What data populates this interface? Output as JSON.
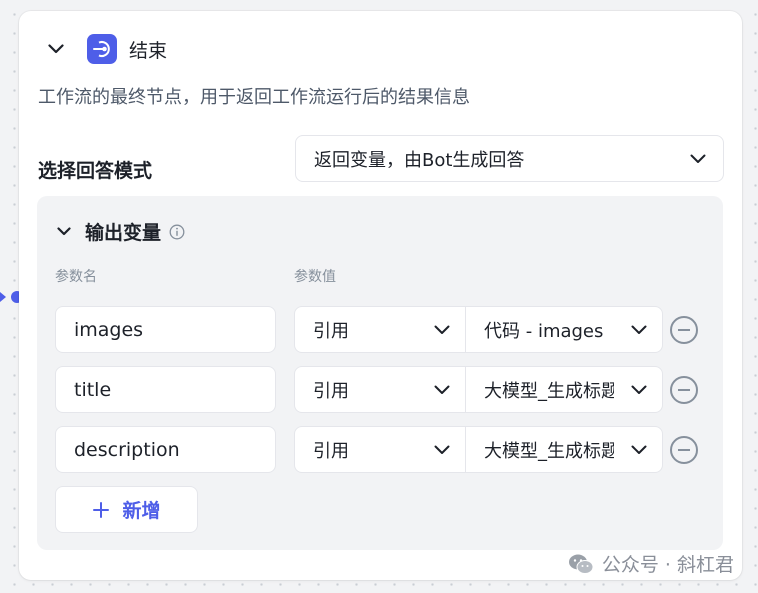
{
  "node": {
    "title": "结束",
    "description": "工作流的最终节点，用于返回工作流运行后的结果信息",
    "icon": "end-node-icon",
    "accent_color": "#4e5ee8"
  },
  "answer_mode": {
    "label": "选择回答模式",
    "selected": "返回变量，由Bot生成回答"
  },
  "output_vars": {
    "title": "输出变量",
    "col_name": "参数名",
    "col_value": "参数值",
    "rows": [
      {
        "name": "images",
        "type": "引用",
        "ref": "代码 - images"
      },
      {
        "name": "title",
        "type": "引用",
        "ref": "大模型_生成标题"
      },
      {
        "name": "description",
        "type": "引用",
        "ref": "大模型_生成标题"
      }
    ],
    "add_label": "新增"
  },
  "watermark": {
    "text": "公众号 · 斜杠君"
  }
}
